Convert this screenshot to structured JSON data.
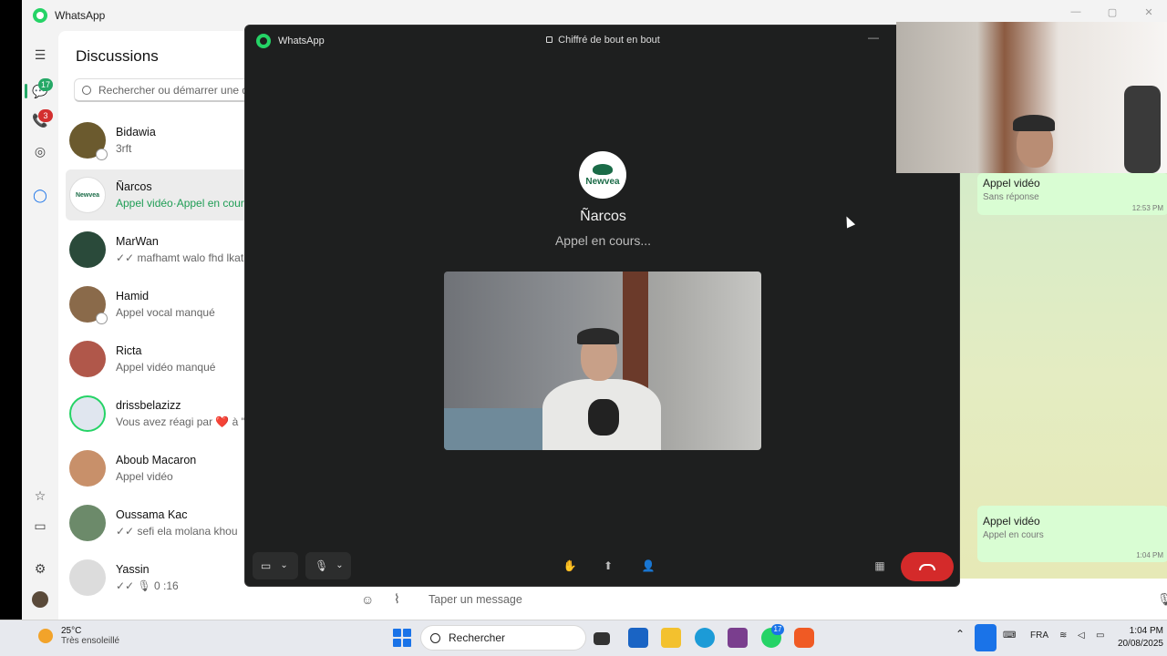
{
  "app": {
    "title": "WhatsApp"
  },
  "rail": {
    "chats_badge": "17",
    "calls_badge": "3"
  },
  "chatlist": {
    "title": "Discussions",
    "search_placeholder": "Rechercher ou démarrer une discussion",
    "items": [
      {
        "name": "Bidawia",
        "preview": "3rft",
        "avatar_color": "#6b5a2e"
      },
      {
        "name": "Ñarcos",
        "preview": "Appel vidéo·Appel en cours",
        "avatar_color": "#ffffff"
      },
      {
        "name": "MarWan",
        "preview": "✓✓ mafhamt walo fhd lkatba",
        "avatar_color": "#2a4a3a"
      },
      {
        "name": "Hamid",
        "preview": "Appel vocal manqué",
        "avatar_color": "#8a6a4a"
      },
      {
        "name": "Ricta",
        "preview": "Appel vidéo manqué",
        "avatar_color": "#b0574a"
      },
      {
        "name": "drissbelazizz",
        "preview": "Vous avez réagi par ❤️ à \"",
        "avatar_color": "#e0e6ef"
      },
      {
        "name": "Aboub Macaron",
        "preview": "Appel vidéo",
        "avatar_color": "#c8906a"
      },
      {
        "name": "Oussama Kac",
        "preview": "✓✓ sefi ela molana khou",
        "avatar_color": "#6c8a6a"
      },
      {
        "name": "Yassin",
        "preview": "✓✓ 🎙 0 :16",
        "avatar_color": "#dcdcdc"
      }
    ]
  },
  "chat": {
    "bubbles": [
      {
        "title": "Appel vidéo",
        "sub": "Sans réponse",
        "time": "12:53 PM"
      },
      {
        "title": "Appel vidéo",
        "sub": "Appel en cours",
        "time": "1:04 PM"
      }
    ],
    "composer_placeholder": "Taper un message"
  },
  "call": {
    "window_title": "WhatsApp",
    "encryption": "Chiffré de bout en bout",
    "callee_name": "Ñarcos",
    "callee_logo_text": "Newvea",
    "status": "Appel en cours..."
  },
  "taskbar": {
    "temp": "25°C",
    "weather": "Très ensoleillé",
    "search": "Rechercher",
    "whatsapp_badge": "17",
    "language": "FRA",
    "time": "1:04 PM",
    "date": "20/08/2025"
  },
  "colors": {
    "whatsapp_green": "#25d366",
    "end_call_red": "#d42a2a",
    "accent_blue": "#1a73e8"
  }
}
